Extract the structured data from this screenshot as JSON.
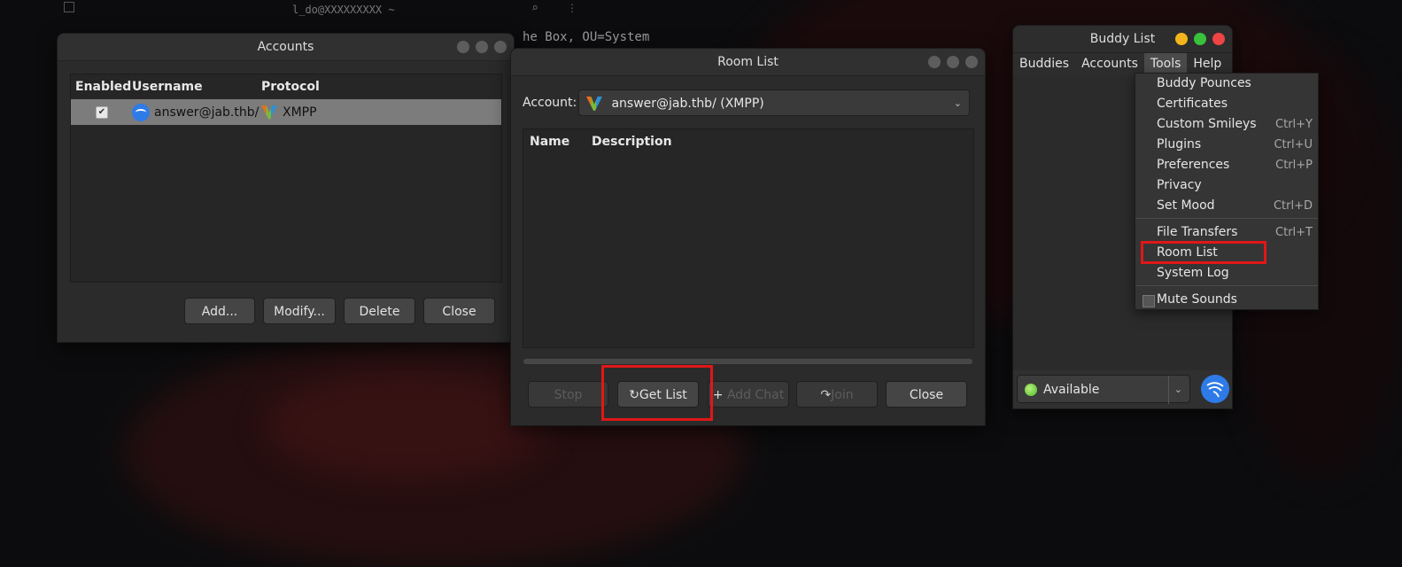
{
  "terminal": {
    "title": "l_do@XXXXXXXXX ~",
    "visible_text": "he Box, OU=System"
  },
  "accounts_window": {
    "title": "Accounts",
    "columns": [
      "Enabled",
      "Username",
      "Protocol"
    ],
    "rows": [
      {
        "enabled": true,
        "username": "answer@jab.thb/",
        "protocol": "XMPP"
      }
    ],
    "buttons": {
      "add": "Add...",
      "modify": "Modify...",
      "delete": "Delete",
      "close": "Close"
    }
  },
  "roomlist_window": {
    "title": "Room List",
    "account_label": "Account:",
    "account_value": "answer@jab.thb/ (XMPP)",
    "columns": [
      "Name",
      "Description"
    ],
    "buttons": {
      "stop": "Stop",
      "get_list": "Get List",
      "add_chat": "Add Chat",
      "join": "Join",
      "close": "Close"
    }
  },
  "buddy_window": {
    "title": "Buddy List",
    "menu": [
      "Buddies",
      "Accounts",
      "Tools",
      "Help"
    ],
    "active_menu": "Tools",
    "status": "Available"
  },
  "tools_menu": {
    "items": [
      {
        "label": "Buddy Pounces",
        "accel": ""
      },
      {
        "label": "Certificates",
        "accel": ""
      },
      {
        "label": "Custom Smileys",
        "accel": "Ctrl+Y"
      },
      {
        "label": "Plugins",
        "accel": "Ctrl+U"
      },
      {
        "label": "Preferences",
        "accel": "Ctrl+P"
      },
      {
        "label": "Privacy",
        "accel": ""
      },
      {
        "label": "Set Mood",
        "accel": "Ctrl+D"
      },
      {
        "label": "File Transfers",
        "accel": "Ctrl+T"
      },
      {
        "label": "Room List",
        "accel": ""
      },
      {
        "label": "System Log",
        "accel": ""
      },
      {
        "label": "Mute Sounds",
        "accel": ""
      }
    ]
  },
  "colors": {
    "highlight_box": "#e01717",
    "accent": "#2e7be8",
    "status_green": "#4cb82a"
  }
}
